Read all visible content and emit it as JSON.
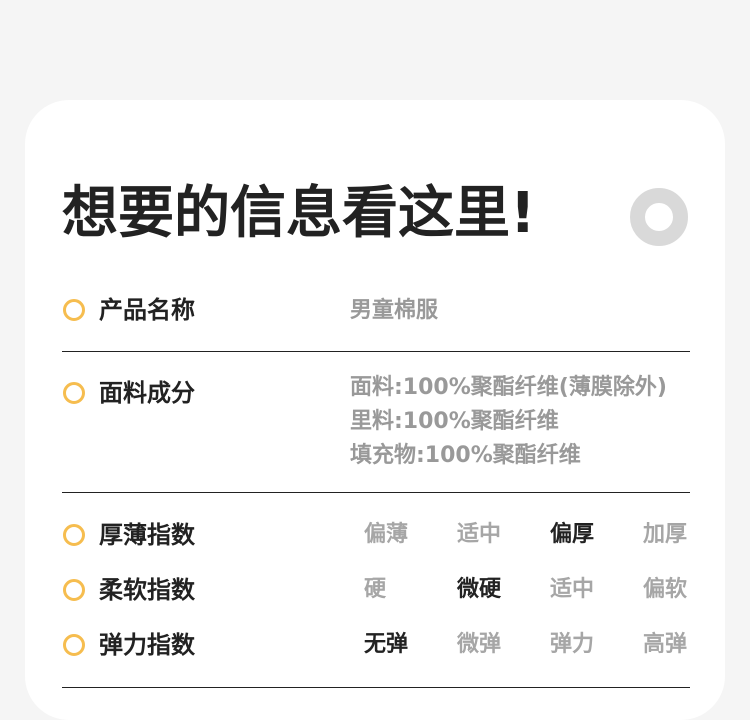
{
  "title": "想要的信息看这里!",
  "colors": {
    "accent_ring": "#f6bd4f",
    "deco_ring": "#d9d9d9",
    "selected": "#222222",
    "unselected": "#a6a6a6"
  },
  "rows": {
    "name": {
      "label": "产品名称",
      "value": "男童棉服"
    },
    "fabric": {
      "label": "面料成分",
      "lines": [
        "面料:100%聚酯纤维(薄膜除外)",
        "里料:100%聚酯纤维",
        "填充物:100%聚酯纤维"
      ]
    },
    "thickness": {
      "label": "厚薄指数",
      "options": [
        "偏薄",
        "适中",
        "偏厚",
        "加厚"
      ],
      "selected": "偏厚"
    },
    "softness": {
      "label": "柔软指数",
      "options": [
        "硬",
        "微硬",
        "适中",
        "偏软"
      ],
      "selected": "微硬"
    },
    "elasticity": {
      "label": "弹力指数",
      "options": [
        "无弹",
        "微弹",
        "弹力",
        "高弹"
      ],
      "selected": "无弹"
    }
  }
}
